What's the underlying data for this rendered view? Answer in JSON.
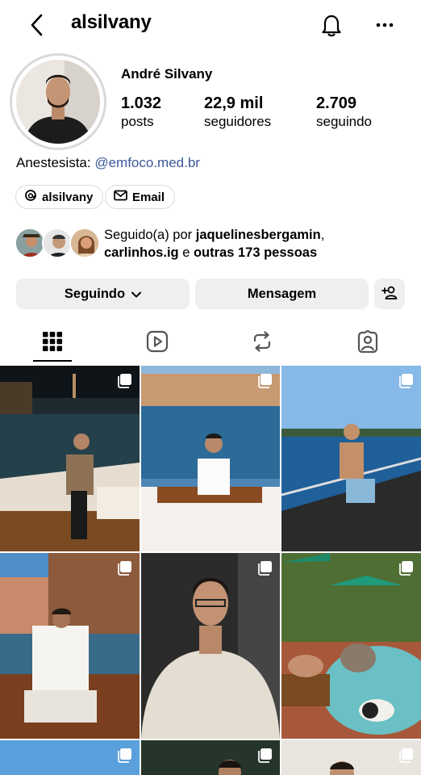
{
  "header": {
    "username": "alsilvany"
  },
  "profile": {
    "full_name": "André Silvany",
    "stats": [
      {
        "value": "1.032",
        "label": "posts"
      },
      {
        "value": "22,9 mil",
        "label": "seguidores"
      },
      {
        "value": "2.709",
        "label": "seguindo"
      }
    ],
    "bio_prefix": "Anestesista: ",
    "bio_link": "@emfoco.med.br"
  },
  "chips": {
    "threads": "alsilvany",
    "email": "Email"
  },
  "followed_by": {
    "prefix": "Seguido(a) por ",
    "user1": "jaquelinesbergamin",
    "sep": ",",
    "user2": "carlinhos.ig",
    "middle": " e ",
    "rest": "outras 173 pessoas"
  },
  "actions": {
    "following": "Seguindo",
    "message": "Mensagem"
  },
  "tabs": [
    "posts-grid",
    "reels",
    "reposts",
    "tagged"
  ],
  "colors": {
    "link": "#3b5998",
    "button_bg": "#efefef",
    "divider": "#dbdbdb"
  },
  "grid_posts": [
    {
      "scene": "night boat canal",
      "multi": true
    },
    {
      "scene": "day boat deck",
      "multi": true
    },
    {
      "scene": "ship railing sea",
      "multi": true
    },
    {
      "scene": "canal boat sitting",
      "multi": true
    },
    {
      "scene": "hoodie portrait",
      "multi": true
    },
    {
      "scene": "pool with dog",
      "multi": true
    },
    {
      "scene": "sky",
      "multi": true
    },
    {
      "scene": "dark portrait",
      "multi": true
    },
    {
      "scene": "light portrait",
      "multi": true
    }
  ]
}
